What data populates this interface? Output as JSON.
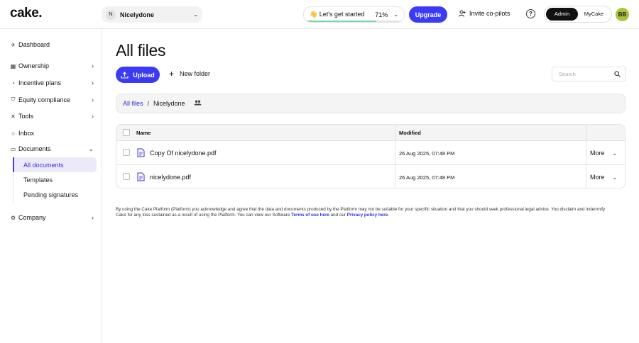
{
  "header": {
    "logo": "cake.",
    "company": {
      "initial": "N",
      "name": "Nicelydone"
    },
    "progress": {
      "label": "👋 Let's get started",
      "value": "71%"
    },
    "upgrade_label": "Upgrade",
    "invite_label": "Invite co-pilots",
    "help_icon": "question-circle-icon",
    "roles": [
      "Admin",
      "MyCake"
    ],
    "active_role": "Admin",
    "avatar_initials": "BB"
  },
  "sidebar": {
    "items": [
      {
        "label": "Dashboard",
        "icon": "rocket-icon"
      },
      {
        "label": "Ownership",
        "icon": "grid-icon"
      },
      {
        "label": "Incentive plans",
        "icon": "clock-icon"
      },
      {
        "label": "Equity compliance",
        "icon": "shield-icon"
      },
      {
        "label": "Tools",
        "icon": "tools-icon"
      },
      {
        "label": "Inbox",
        "icon": "chat-icon"
      },
      {
        "label": "Documents",
        "icon": "folder-icon"
      },
      {
        "label": "Company",
        "icon": "gear-icon"
      }
    ],
    "documents_sub": [
      "All documents",
      "Templates",
      "Pending signatures"
    ]
  },
  "main": {
    "title": "All files",
    "upload_label": "Upload",
    "new_folder_label": "New folder",
    "search_placeholder": "Search",
    "breadcrumb": {
      "root": "All files",
      "separator": "/",
      "current": "Nicelydone"
    },
    "table": {
      "headers": {
        "name": "Name",
        "modified": "Modified"
      },
      "rows": [
        {
          "name": "Copy Of nicelydone.pdf",
          "modified": "26 Aug 2025, 07:48 PM",
          "action": "More"
        },
        {
          "name": "nicelydone.pdf",
          "modified": "26 Aug 2025, 07:48 PM",
          "action": "More"
        }
      ]
    },
    "disclaimer": {
      "text": "By using the Cake Platform (Platform) you acknowledge and agree that the data and documents produced by the Platform may not be suitable for your specific situation and that you should seek professional legal advice. You disclaim and indemnify Cake for any loss sustained as a result of using the Platform. You can view our Software",
      "terms_link": "Terms of use here",
      "and": "and our",
      "privacy_link": "Privacy policy here."
    }
  },
  "colors": {
    "accent": "#3b3bf5",
    "progress": "#7bd3b2",
    "avatar": "#a7c43a",
    "active_nav": "#eceaf9"
  }
}
